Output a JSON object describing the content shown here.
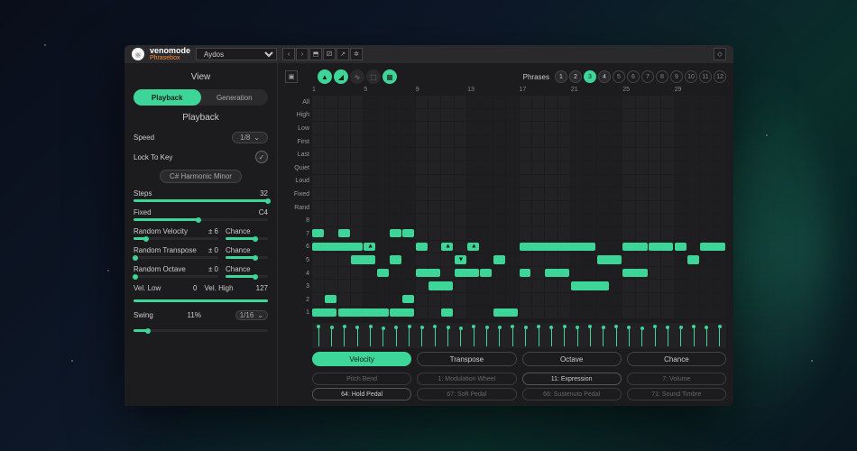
{
  "brand": {
    "name": "venomode",
    "product": "Phrasebox"
  },
  "preset": "Aydos",
  "topbar_icons": [
    "prev",
    "next",
    "save",
    "random",
    "link",
    "settings"
  ],
  "view": {
    "title": "View",
    "tabs": [
      "Playback",
      "Generation"
    ],
    "active": 0
  },
  "playback": {
    "title": "Playback",
    "speed": {
      "label": "Speed",
      "value": "1/8"
    },
    "lock": {
      "label": "Lock To Key",
      "checked": true
    },
    "scale": "C# Harmonic Minor",
    "steps": {
      "label": "Steps",
      "value": "32",
      "pct": 100
    },
    "fixed": {
      "label": "Fixed",
      "value": "C4",
      "pct": 48
    },
    "rand_vel": {
      "label": "Random Velocity",
      "value": "± 6",
      "pct": 15,
      "chance": "Chance",
      "chance_pct": 70
    },
    "rand_trans": {
      "label": "Random Transpose",
      "value": "± 0",
      "pct": 2,
      "chance": "Chance",
      "chance_pct": 70
    },
    "rand_oct": {
      "label": "Random Octave",
      "value": "± 0",
      "pct": 2,
      "chance": "Chance",
      "chance_pct": 70
    },
    "vel_low": {
      "label": "Vel. Low",
      "value": "0"
    },
    "vel_high": {
      "label": "Vel. High",
      "value": "127"
    },
    "swing": {
      "label": "Swing",
      "value": "11%",
      "pct": 11,
      "rate": "1/16"
    }
  },
  "phrases": {
    "label": "Phrases",
    "count": 12,
    "filled": [
      1,
      2,
      3,
      4
    ],
    "active": 3
  },
  "grid": {
    "col_numbers": [
      1,
      5,
      9,
      13,
      17,
      21,
      25,
      29
    ],
    "row_labels": [
      "All",
      "High",
      "Low",
      "First",
      "Last",
      "Quiet",
      "Loud",
      "Fixed",
      "Rand",
      "8",
      "7",
      "6",
      "5",
      "4",
      "3",
      "2",
      "1"
    ],
    "notes": [
      {
        "row": 10,
        "start": 0,
        "len": 1
      },
      {
        "row": 10,
        "start": 2,
        "len": 1
      },
      {
        "row": 10,
        "start": 6,
        "len": 1
      },
      {
        "row": 10,
        "start": 7,
        "len": 1
      },
      {
        "row": 11,
        "start": 0,
        "len": 4
      },
      {
        "row": 11,
        "start": 4,
        "len": 1
      },
      {
        "row": 11,
        "start": 8,
        "len": 1
      },
      {
        "row": 11,
        "start": 10,
        "len": 1
      },
      {
        "row": 11,
        "start": 12,
        "len": 1
      },
      {
        "row": 11,
        "start": 16,
        "len": 6
      },
      {
        "row": 11,
        "start": 24,
        "len": 2
      },
      {
        "row": 11,
        "start": 26,
        "len": 2
      },
      {
        "row": 11,
        "start": 28,
        "len": 1
      },
      {
        "row": 11,
        "start": 30,
        "len": 2
      },
      {
        "row": 12,
        "start": 3,
        "len": 2
      },
      {
        "row": 12,
        "start": 6,
        "len": 1
      },
      {
        "row": 12,
        "start": 11,
        "len": 1
      },
      {
        "row": 12,
        "start": 14,
        "len": 1
      },
      {
        "row": 12,
        "start": 22,
        "len": 2
      },
      {
        "row": 12,
        "start": 29,
        "len": 1
      },
      {
        "row": 13,
        "start": 5,
        "len": 1
      },
      {
        "row": 13,
        "start": 8,
        "len": 2
      },
      {
        "row": 13,
        "start": 11,
        "len": 2
      },
      {
        "row": 13,
        "start": 13,
        "len": 1
      },
      {
        "row": 13,
        "start": 16,
        "len": 1
      },
      {
        "row": 13,
        "start": 18,
        "len": 2
      },
      {
        "row": 13,
        "start": 24,
        "len": 2
      },
      {
        "row": 14,
        "start": 9,
        "len": 2
      },
      {
        "row": 14,
        "start": 20,
        "len": 3
      },
      {
        "row": 15,
        "start": 1,
        "len": 1
      },
      {
        "row": 15,
        "start": 7,
        "len": 1
      },
      {
        "row": 16,
        "start": 0,
        "len": 2
      },
      {
        "row": 16,
        "start": 2,
        "len": 4
      },
      {
        "row": 16,
        "start": 6,
        "len": 2
      },
      {
        "row": 16,
        "start": 10,
        "len": 1
      },
      {
        "row": 16,
        "start": 14,
        "len": 2
      }
    ],
    "arrows": [
      {
        "row": 11,
        "col": 4,
        "dir": "up"
      },
      {
        "row": 11,
        "col": 10,
        "dir": "up"
      },
      {
        "row": 12,
        "col": 11,
        "dir": "down"
      },
      {
        "row": 11,
        "col": 12,
        "dir": "up"
      }
    ]
  },
  "velocity": {
    "heights": [
      85,
      80,
      82,
      78,
      85,
      75,
      80,
      82,
      78,
      85,
      80,
      75,
      82,
      80,
      78,
      85,
      80,
      82,
      78,
      85,
      80,
      82,
      78,
      85,
      80,
      75,
      82,
      80,
      78,
      85,
      80,
      82
    ]
  },
  "bottom_tabs": {
    "items": [
      "Velocity",
      "Transpose",
      "Octave",
      "Chance"
    ],
    "active": 0
  },
  "cc": {
    "row1": [
      "Pitch Bend",
      "1: Modulation Wheel",
      "11: Expression",
      "7: Volume"
    ],
    "row2": [
      "64: Hold Pedal",
      "67: Soft Pedal",
      "66: Sustenuto Pedal",
      "71: Sound Timbre"
    ],
    "active": [
      2,
      0
    ]
  }
}
